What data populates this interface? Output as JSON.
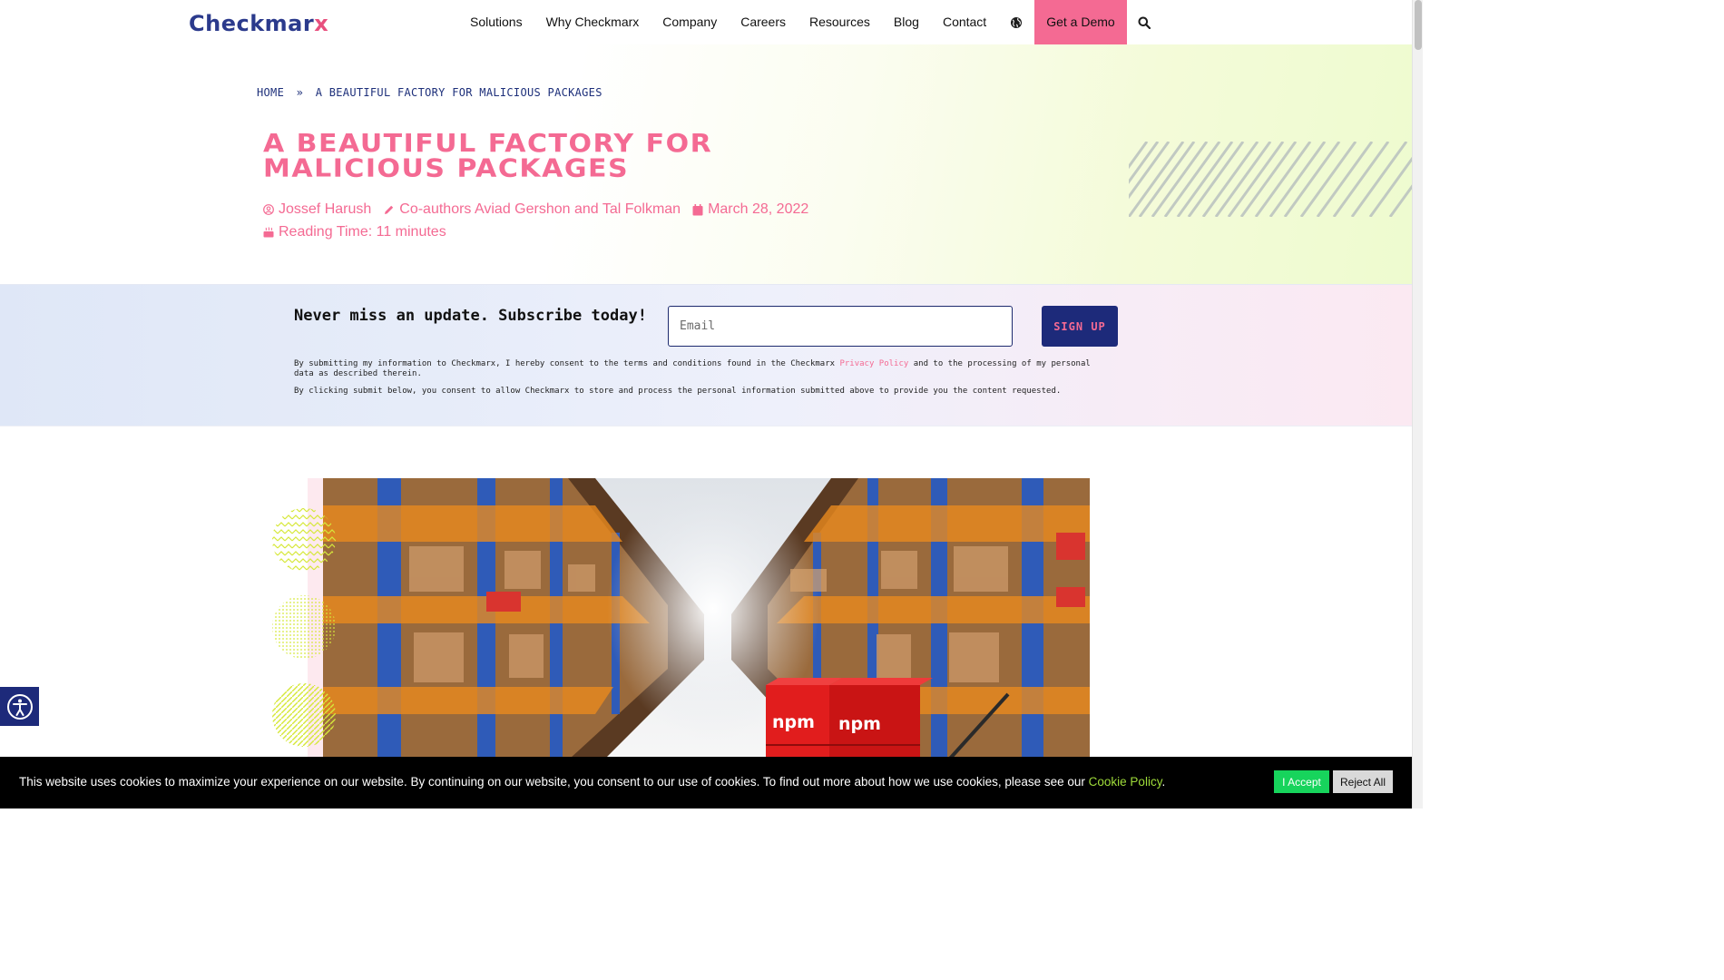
{
  "header": {
    "logo": "Checkmarx",
    "nav": [
      "Solutions",
      "Why Checkmarx",
      "Company",
      "Careers",
      "Resources",
      "Blog",
      "Contact"
    ],
    "cta": "Get a Demo",
    "icons": [
      "globe-icon",
      "search-icon"
    ]
  },
  "breadcrumb": {
    "home": "HOME",
    "sep": "»",
    "current": "A BEAUTIFUL FACTORY FOR MALICIOUS PACKAGES"
  },
  "article": {
    "title": "A BEAUTIFUL FACTORY FOR MALICIOUS PACKAGES",
    "author": "Jossef Harush",
    "coauthors": "Co-authors Aviad Gershon and Tal Folkman",
    "date": "March 28, 2022",
    "reading_time": "Reading Time: 11 minutes"
  },
  "subscribe": {
    "heading": "Never miss an update. Subscribe today!",
    "email_placeholder": "Email",
    "button": "SIGN UP",
    "consent_before": "By submitting my information to Checkmarx, I hereby consent to the terms and conditions found in the Checkmarx ",
    "privacy_link": "Privacy Policy",
    "consent_after": " and to the processing of my personal data as described therein.",
    "consent2": "By clicking submit below, you consent to allow Checkmarx to store and process the personal information submitted above to provide you the content requested."
  },
  "featured_image": {
    "box_labels": [
      "npm",
      "npm"
    ]
  },
  "cookie": {
    "text": "This website uses cookies to maximize your experience on our website. By continuing on our website, you consent to our use of cookies. To find out more about how we use cookies, please see our ",
    "link": "Cookie Policy",
    "end": ".",
    "accept": "I Accept",
    "reject": "Reject All"
  },
  "colors": {
    "brand_pink": "#f46a93",
    "brand_navy": "#1d2a7a",
    "accept_green": "#17d45c"
  }
}
